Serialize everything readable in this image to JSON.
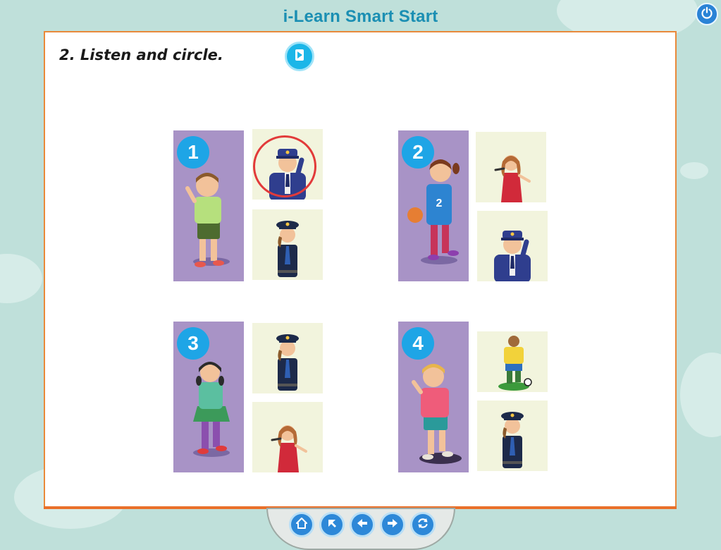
{
  "app": {
    "title": "i-Learn Smart Start"
  },
  "exercise": {
    "title": "2. Listen and circle."
  },
  "questions": [
    {
      "number": "1",
      "child": "boy",
      "options": [
        "pilot",
        "police officer"
      ],
      "circled": "pilot"
    },
    {
      "number": "2",
      "child": "girl with ball",
      "options": [
        "singer",
        "pilot"
      ],
      "circled": null
    },
    {
      "number": "3",
      "child": "girl",
      "options": [
        "police officer",
        "singer"
      ],
      "circled": null
    },
    {
      "number": "4",
      "child": "boy",
      "options": [
        "football player",
        "police officer"
      ],
      "circled": null
    }
  ],
  "icons": {
    "power": "power-icon",
    "audio": "play-icon",
    "nav": [
      "home-icon",
      "back-to-top-icon",
      "previous-icon",
      "next-icon",
      "refresh-icon"
    ]
  },
  "colors": {
    "background": "#bfe0da",
    "accent": "#1b8fb3",
    "page_border": "#e9893a",
    "panel": "#a893c6",
    "badge": "#1ea5e6",
    "circle": "#e23a3a"
  }
}
